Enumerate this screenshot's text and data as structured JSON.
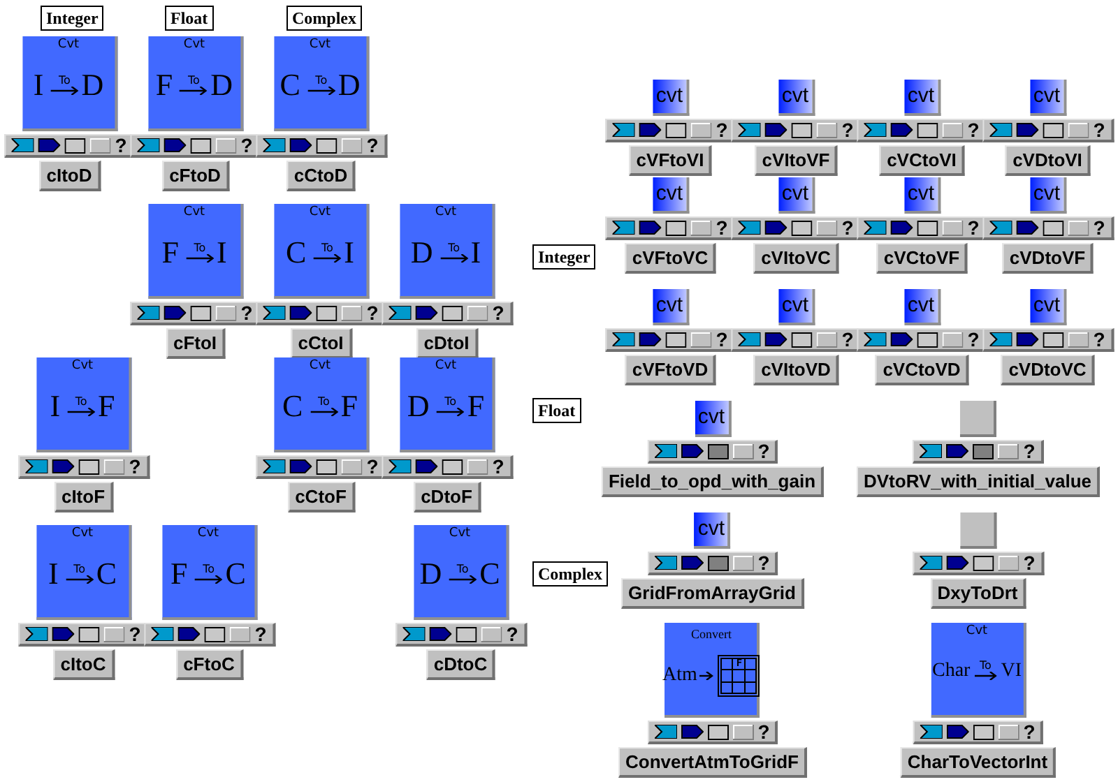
{
  "column_headers": [
    "Integer",
    "Float",
    "Complex"
  ],
  "row_headers": [
    "Integer",
    "Float",
    "Complex"
  ],
  "modules": [
    {
      "name": "cItoD",
      "icon": {
        "kind": "large",
        "caption": "Cvt",
        "from": "I",
        "over": "To",
        "to": "D"
      },
      "toolbar": {
        "filled": false,
        "help": "?"
      }
    },
    {
      "name": "cFtoD",
      "icon": {
        "kind": "large",
        "caption": "Cvt",
        "from": "F",
        "over": "To",
        "to": "D"
      },
      "toolbar": {
        "filled": false,
        "help": "?"
      }
    },
    {
      "name": "cCtoD",
      "icon": {
        "kind": "large",
        "caption": "Cvt",
        "from": "C",
        "over": "To",
        "to": "D"
      },
      "toolbar": {
        "filled": false,
        "help": "?"
      }
    },
    {
      "name": "cFtoI",
      "icon": {
        "kind": "large",
        "caption": "Cvt",
        "from": "F",
        "over": "To",
        "to": "I"
      },
      "toolbar": {
        "filled": false,
        "help": "?"
      }
    },
    {
      "name": "cCtoI",
      "icon": {
        "kind": "large",
        "caption": "Cvt",
        "from": "C",
        "over": "To",
        "to": "I"
      },
      "toolbar": {
        "filled": false,
        "help": "?"
      }
    },
    {
      "name": "cDtoI",
      "icon": {
        "kind": "large",
        "caption": "Cvt",
        "from": "D",
        "over": "To",
        "to": "I"
      },
      "toolbar": {
        "filled": false,
        "help": "?"
      }
    },
    {
      "name": "cItoF",
      "icon": {
        "kind": "large",
        "caption": "Cvt",
        "from": "I",
        "over": "To",
        "to": "F"
      },
      "toolbar": {
        "filled": false,
        "help": "?"
      }
    },
    {
      "name": "cCtoF",
      "icon": {
        "kind": "large",
        "caption": "Cvt",
        "from": "C",
        "over": "To",
        "to": "F"
      },
      "toolbar": {
        "filled": false,
        "help": "?"
      }
    },
    {
      "name": "cDtoF",
      "icon": {
        "kind": "large",
        "caption": "Cvt",
        "from": "D",
        "over": "To",
        "to": "F"
      },
      "toolbar": {
        "filled": false,
        "help": "?"
      }
    },
    {
      "name": "cItoC",
      "icon": {
        "kind": "large",
        "caption": "Cvt",
        "from": "I",
        "over": "To",
        "to": "C"
      },
      "toolbar": {
        "filled": false,
        "help": "?"
      }
    },
    {
      "name": "cFtoC",
      "icon": {
        "kind": "large",
        "caption": "Cvt",
        "from": "F",
        "over": "To",
        "to": "C"
      },
      "toolbar": {
        "filled": false,
        "help": "?"
      }
    },
    {
      "name": "cDtoC",
      "icon": {
        "kind": "large",
        "caption": "Cvt",
        "from": "D",
        "over": "To",
        "to": "C"
      },
      "toolbar": {
        "filled": false,
        "help": "?"
      }
    },
    {
      "name": "cVFtoVI",
      "icon": {
        "kind": "small",
        "caption": "cvt"
      },
      "toolbar": {
        "filled": false,
        "help": "?"
      }
    },
    {
      "name": "cVItoVF",
      "icon": {
        "kind": "small",
        "caption": "cvt"
      },
      "toolbar": {
        "filled": false,
        "help": "?"
      }
    },
    {
      "name": "cVCtoVI",
      "icon": {
        "kind": "small",
        "caption": "cvt"
      },
      "toolbar": {
        "filled": false,
        "help": "?"
      }
    },
    {
      "name": "cVDtoVI",
      "icon": {
        "kind": "small",
        "caption": "cvt"
      },
      "toolbar": {
        "filled": false,
        "help": "?"
      }
    },
    {
      "name": "cVFtoVC",
      "icon": {
        "kind": "small",
        "caption": "cvt"
      },
      "toolbar": {
        "filled": false,
        "help": "?"
      }
    },
    {
      "name": "cVItoVC",
      "icon": {
        "kind": "small",
        "caption": "cvt"
      },
      "toolbar": {
        "filled": false,
        "help": "?"
      }
    },
    {
      "name": "cVCtoVF",
      "icon": {
        "kind": "small",
        "caption": "cvt"
      },
      "toolbar": {
        "filled": false,
        "help": "?"
      }
    },
    {
      "name": "cVDtoVF",
      "icon": {
        "kind": "small",
        "caption": "cvt"
      },
      "toolbar": {
        "filled": false,
        "help": "?"
      }
    },
    {
      "name": "cVFtoVD",
      "icon": {
        "kind": "small",
        "caption": "cvt"
      },
      "toolbar": {
        "filled": false,
        "help": "?"
      }
    },
    {
      "name": "cVItoVD",
      "icon": {
        "kind": "small",
        "caption": "cvt"
      },
      "toolbar": {
        "filled": false,
        "help": "?"
      }
    },
    {
      "name": "cVCtoVD",
      "icon": {
        "kind": "small",
        "caption": "cvt"
      },
      "toolbar": {
        "filled": false,
        "help": "?"
      }
    },
    {
      "name": "cVDtoVC",
      "icon": {
        "kind": "small",
        "caption": "cvt"
      },
      "toolbar": {
        "filled": false,
        "help": "?"
      }
    },
    {
      "name": "Field_to_opd_with_gain",
      "icon": {
        "kind": "small",
        "caption": "cvt"
      },
      "toolbar": {
        "filled": true,
        "help": "?"
      }
    },
    {
      "name": "DVtoRV_with_initial_value",
      "icon": {
        "kind": "blank"
      },
      "toolbar": {
        "filled": true,
        "help": "?"
      }
    },
    {
      "name": "GridFromArrayGrid",
      "icon": {
        "kind": "small",
        "caption": "cvt"
      },
      "toolbar": {
        "filled": true,
        "help": "?"
      }
    },
    {
      "name": "DxyToDrt",
      "icon": {
        "kind": "blank"
      },
      "toolbar": {
        "filled": false,
        "help": "?"
      }
    },
    {
      "name": "ConvertAtmToGridF",
      "icon": {
        "kind": "grid",
        "caption": "Convert",
        "from": "Atm",
        "cell": "F"
      },
      "toolbar": {
        "filled": false,
        "help": "?"
      }
    },
    {
      "name": "CharToVectorInt",
      "icon": {
        "kind": "large",
        "caption": "Cvt",
        "from": "Char",
        "over": "To",
        "to": "VI"
      },
      "toolbar": {
        "filled": false,
        "help": "?"
      }
    }
  ]
}
